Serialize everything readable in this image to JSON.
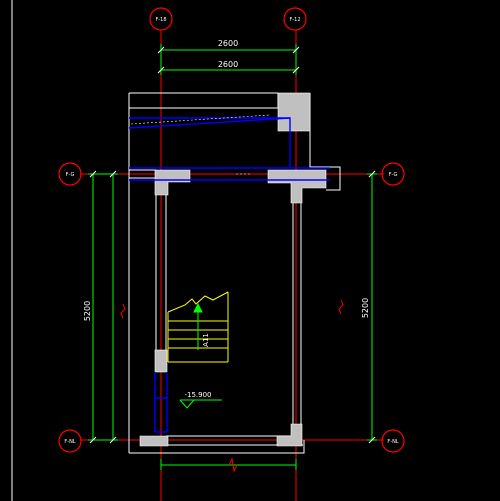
{
  "axis_bubbles": {
    "top_left": "F-18",
    "top_right": "F-12",
    "mid_left": "F-G",
    "mid_right": "F-G",
    "bottom_left": "F-NL",
    "bottom_right": "F-NL"
  },
  "dimensions": {
    "top_outer": "2600",
    "top_inner": "2600",
    "left_outer": "5200",
    "right": "5200"
  },
  "annotations": {
    "stair_label": "A11",
    "elevation": "-15.900"
  },
  "colors": {
    "background": "#000000",
    "axis_red": "#ff0000",
    "dim_green": "#00ff00",
    "wall_blue": "#0000ff",
    "stair_yellow": "#ffff00",
    "wall_white": "#ffffff",
    "column_gray": "#c0c0c0"
  }
}
